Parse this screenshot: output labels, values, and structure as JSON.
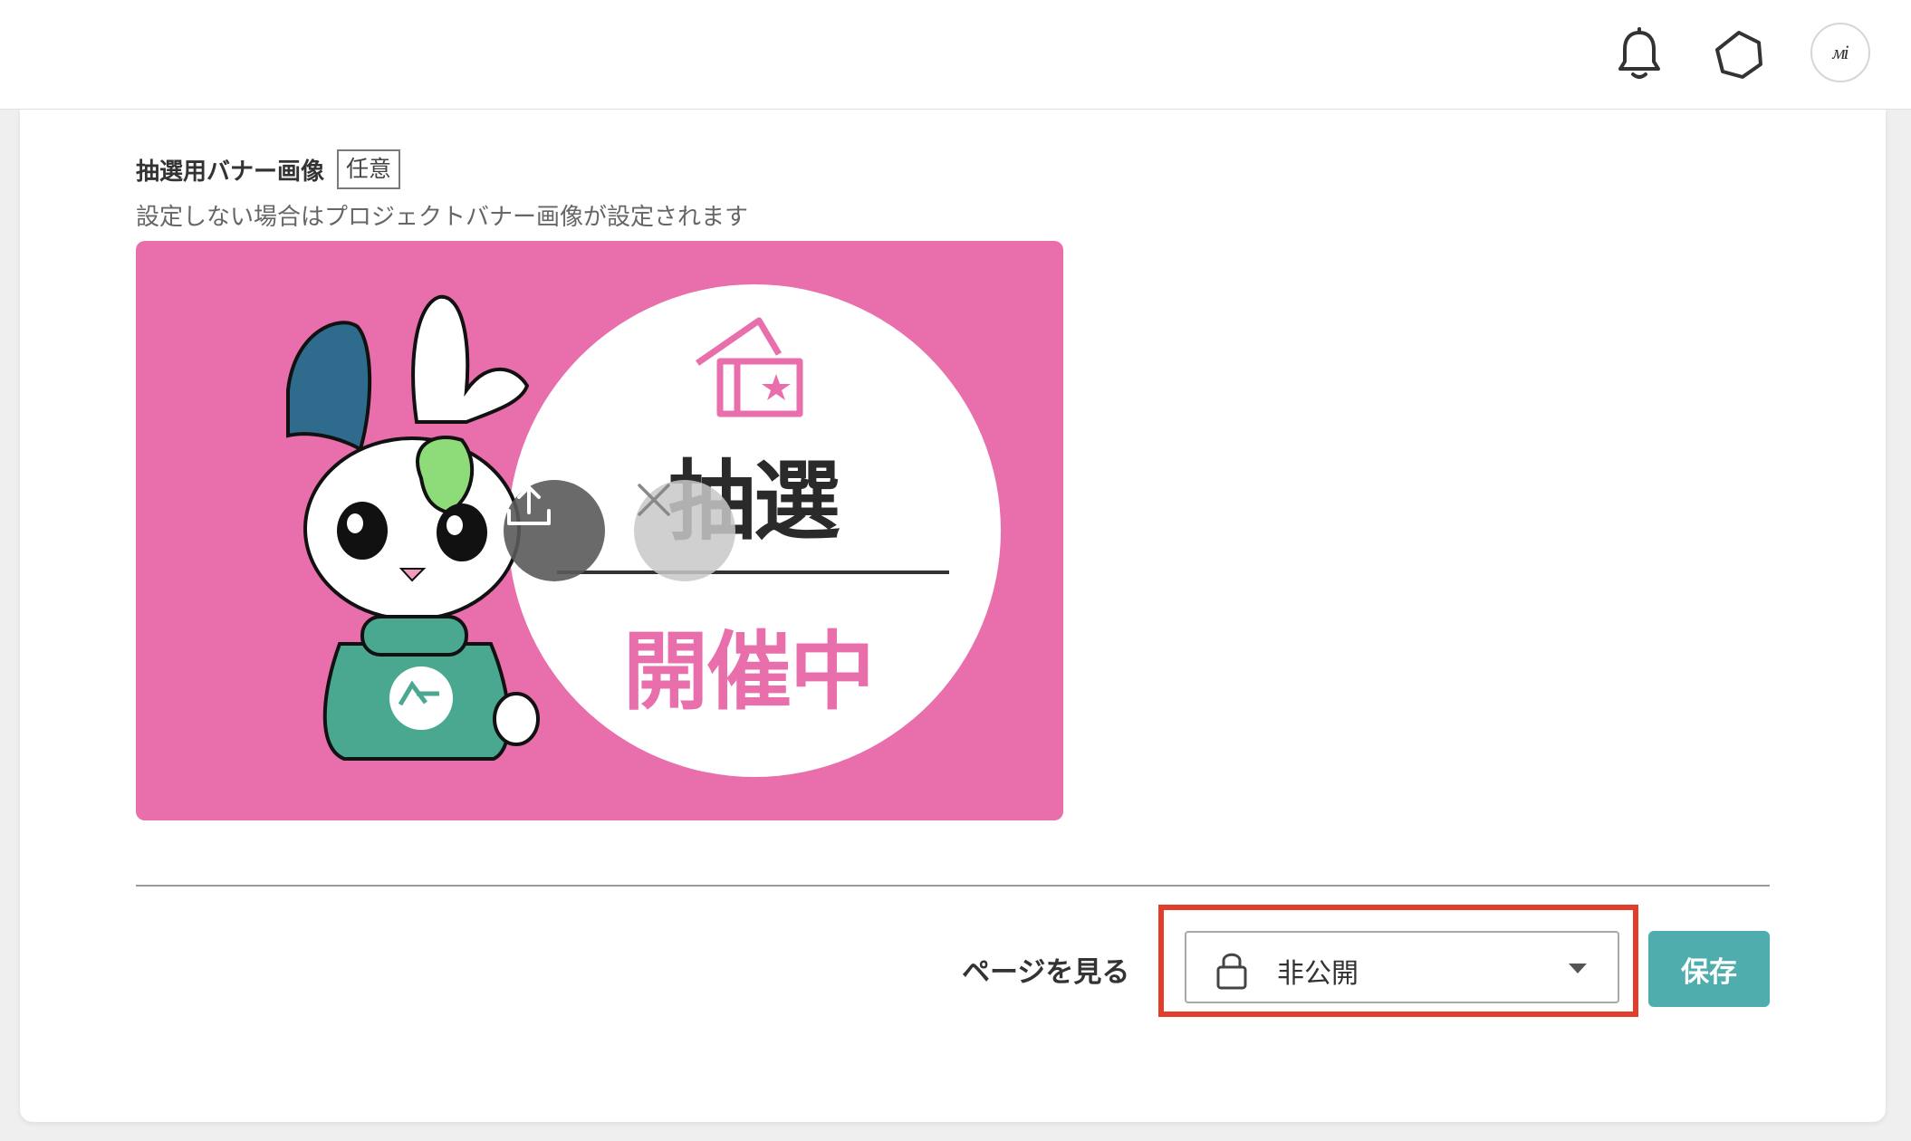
{
  "header": {
    "notification_icon": "bell-icon",
    "settings_icon": "hexagon-icon",
    "avatar_text": "ᴍi"
  },
  "banner_field": {
    "title": "抽選用バナー画像",
    "badge": "任意",
    "description": "設定しない場合はプロジェクトバナー画像が設定されます",
    "image": {
      "background_color": "#e86eac",
      "text_top": "抽選",
      "text_bottom": "開催中",
      "text_bottom_color": "#e86eac"
    },
    "upload_icon": "upload-icon",
    "delete_icon": "close-icon"
  },
  "footer": {
    "view_page_label": "ページを見る",
    "visibility": {
      "value": "非公開",
      "icon": "lock-icon"
    },
    "save_label": "保存",
    "accent_color": "#4faead",
    "highlight_color": "#e23d2a"
  }
}
